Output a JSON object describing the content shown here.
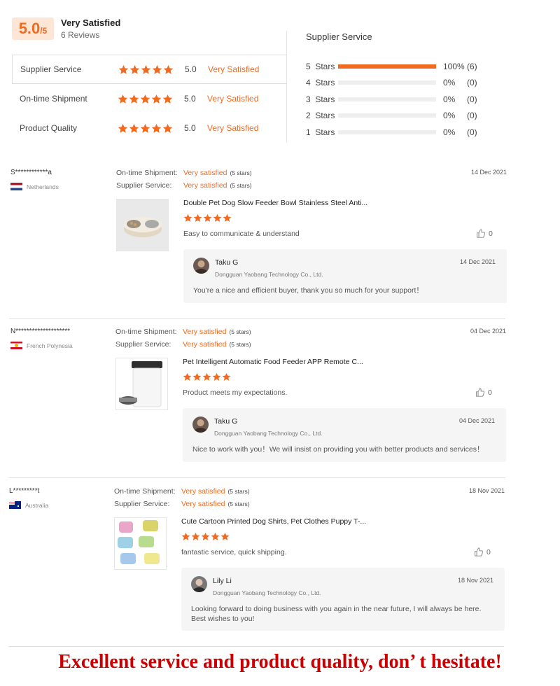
{
  "summary": {
    "score": "5.0",
    "score_max": "/5",
    "title": "Very Satisfied",
    "count": "6 Reviews",
    "categories": [
      {
        "name": "Supplier Service",
        "score": "5.0",
        "label": "Very Satisfied",
        "stars": 5
      },
      {
        "name": "On-time Shipment",
        "score": "5.0",
        "label": "Very Satisfied",
        "stars": 5
      },
      {
        "name": "Product Quality",
        "score": "5.0",
        "label": "Very Satisfied",
        "stars": 5
      }
    ]
  },
  "distribution": {
    "title": "Supplier Service",
    "rows": [
      {
        "label": "5  Stars",
        "fraction": 1.0,
        "pct": "100%",
        "count": "(6)"
      },
      {
        "label": "4  Stars",
        "fraction": 0.0,
        "pct": "0%",
        "count": "(0)"
      },
      {
        "label": "3  Stars",
        "fraction": 0.0,
        "pct": "0%",
        "count": "(0)"
      },
      {
        "label": "2  Stars",
        "fraction": 0.0,
        "pct": "0%",
        "count": "(0)"
      },
      {
        "label": "1  Stars",
        "fraction": 0.0,
        "pct": "0%",
        "count": "(0)"
      }
    ]
  },
  "meta_labels": {
    "shipment": "On-time Shipment:",
    "service": "Supplier Service:"
  },
  "reviews": [
    {
      "user": "S************a",
      "country": "Netherlands",
      "flag": "netherlands-flag",
      "shipment": "Very satisfied",
      "shipment_stars": "(5 stars)",
      "service": "Very satisfied",
      "service_stars": "(5 stars)",
      "date": "14 Dec 2021",
      "product_icon": "pet-bowl-image",
      "product": "Double Pet Dog Slow Feeder Bowl Stainless Steel Anti...",
      "rating": 5,
      "comment": "Easy to communicate & understand",
      "likes": "0",
      "reply": {
        "name": "Taku G",
        "company": "Dongguan Yaobang Technology Co., Ltd.",
        "date": "14 Dec 2021",
        "text": "You're a nice and efficient buyer, thank you so much for your support！"
      }
    },
    {
      "user": "N********************",
      "country": "French Polynesia",
      "flag": "french-polynesia-flag",
      "shipment": "Very satisfied",
      "shipment_stars": "(5 stars)",
      "service": "Very satisfied",
      "service_stars": "(5 stars)",
      "date": "04 Dec 2021",
      "product_icon": "pet-feeder-image",
      "product": "Pet Intelligent Automatic Food Feeder APP Remote C...",
      "rating": 5,
      "comment": "Product meets my expectations.",
      "likes": "0",
      "reply": {
        "name": "Taku G",
        "company": "Dongguan Yaobang Technology Co., Ltd.",
        "date": "04 Dec 2021",
        "text": "Nice to work with you！We will insist on providing you with better products and services！"
      }
    },
    {
      "user": "L*********t",
      "country": "Australia",
      "flag": "australia-flag",
      "shipment": "Very satisfied",
      "shipment_stars": "(5 stars)",
      "service": "Very satisfied",
      "service_stars": "(5 stars)",
      "date": "18 Nov 2021",
      "product_icon": "dog-shirts-image",
      "product": "Cute Cartoon Printed Dog Shirts, Pet Clothes Puppy T-...",
      "rating": 5,
      "comment": "fantastic service, quick shipping.",
      "likes": "0",
      "reply": {
        "name": "Lily Li",
        "company": "Dongguan Yaobang Technology Co., Ltd.",
        "date": "18 Nov 2021",
        "text": "Looking forward to doing business with you again in the near future, I will always be here. Best wishes to you!"
      }
    }
  ],
  "banner": "Excellent service and product quality, don’ t hesitate!",
  "colors": {
    "accent": "#f06a1f",
    "banner": "#cc0000"
  }
}
